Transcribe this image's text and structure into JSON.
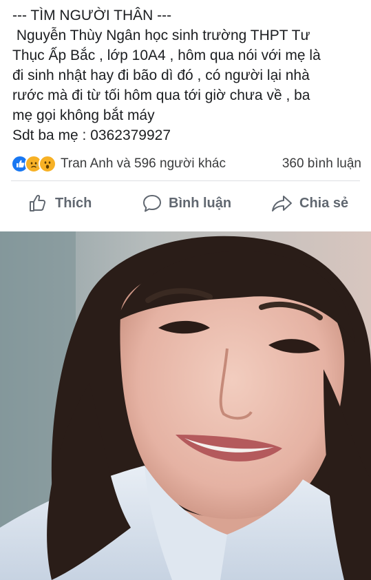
{
  "post": {
    "text_lines": [
      "--- TÌM NGƯỜI THÂN ---",
      " Nguyễn Thùy Ngân học sinh trường THPT Tư",
      "Thục Ấp Bắc , lớp 10A4 , hôm qua nói với mẹ là",
      "đi sinh nhật hay đi bão dì đó , có người lại nhà",
      "rước mà đi từ tối hôm qua tới giờ chưa về , ba",
      "mẹ gọi không bắt máy",
      "Sdt ba mẹ : 0362379927"
    ]
  },
  "reactions": {
    "icons": [
      "like-icon",
      "sad-icon",
      "wow-icon"
    ],
    "names": "Tran Anh và 596 người khác",
    "comment_count": "360 bình luận",
    "like_color": "#1877f2",
    "emoji_color": "#f7b125"
  },
  "actions": {
    "like_label": "Thích",
    "comment_label": "Bình luận",
    "share_label": "Chia sẻ"
  },
  "photo": {
    "subject": "selfie-photo"
  }
}
